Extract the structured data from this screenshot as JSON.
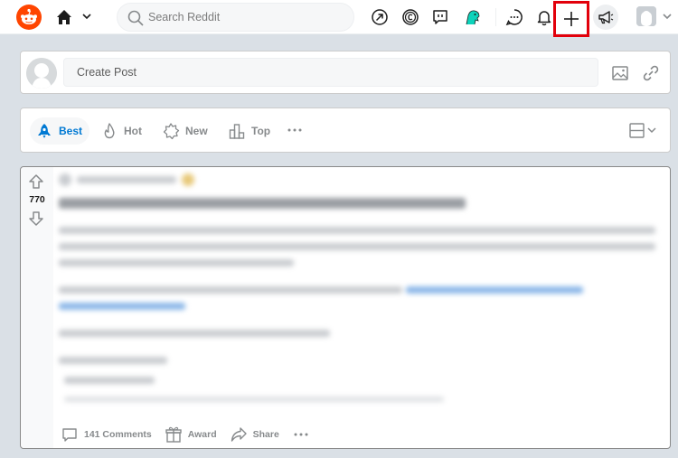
{
  "header": {
    "search_placeholder": "Search Reddit"
  },
  "create_post": {
    "placeholder": "Create Post"
  },
  "sort_options": [
    {
      "label": "Best",
      "active": true
    },
    {
      "label": "Hot",
      "active": false
    },
    {
      "label": "New",
      "active": false
    },
    {
      "label": "Top",
      "active": false
    }
  ],
  "post": {
    "score": "770",
    "comments_label": "141 Comments",
    "award_label": "Award",
    "share_label": "Share"
  },
  "colors": {
    "brand": "#ff4500",
    "accent": "#0079d3",
    "highlight_box": "#e2000b"
  }
}
